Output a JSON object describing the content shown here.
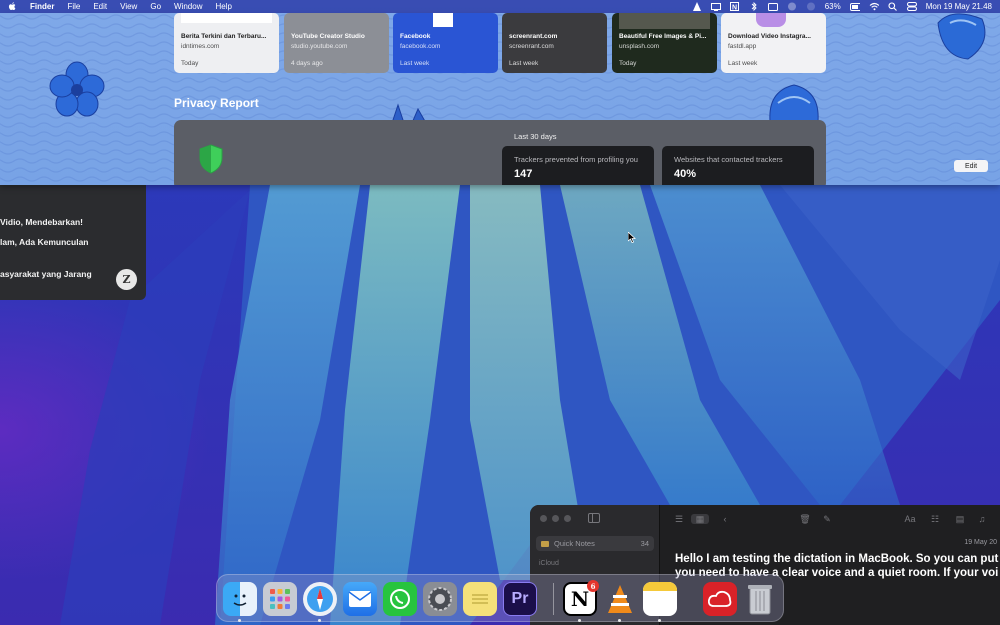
{
  "menubar": {
    "app_name": "Finder",
    "menus": [
      "File",
      "Edit",
      "View",
      "Go",
      "Window",
      "Help"
    ],
    "battery": "63%",
    "datetime": "Mon 19 May  21.48",
    "status_icons": [
      "vlc-icon",
      "display-icon",
      "notion-icon",
      "bluetooth-icon",
      "screen-icon",
      "dictation-icon",
      "shield-icon",
      "battery-icon",
      "wifi-icon",
      "search-icon",
      "control-center-icon"
    ]
  },
  "safari": {
    "cards": [
      {
        "title": "Berita Terkini dan Terbaru...",
        "domain": "idntimes.com",
        "time": "Today",
        "style": "light"
      },
      {
        "title": "YouTube Creator Studio",
        "domain": "studio.youtube.com",
        "time": "4 days ago",
        "style": "gray"
      },
      {
        "title": "Facebook",
        "domain": "facebook.com",
        "time": "Last week",
        "style": "blue"
      },
      {
        "title": "screenrant.com",
        "domain": "screenrant.com",
        "time": "Last week",
        "style": "dark"
      },
      {
        "title": "Beautiful Free Images & Pi...",
        "domain": "unsplash.com",
        "time": "Today",
        "style": "darkgreen"
      },
      {
        "title": "Download Video Instagra...",
        "domain": "fastdl.app",
        "time": "Last week",
        "style": "light"
      }
    ],
    "privacy_title": "Privacy Report",
    "privacy_period": "Last 30 days",
    "trackers_label": "Trackers prevented from profiling you",
    "trackers_value": "147",
    "websites_label": "Websites that contacted trackers",
    "websites_value": "40%",
    "edit_label": "Edit"
  },
  "news": {
    "headlines": [
      "Vidio, Mendebarkan!",
      "lam, Ada Kemunculan",
      "asyarakat yang Jarang"
    ]
  },
  "notes": {
    "folder_name": "Quick Notes",
    "folder_count": "34",
    "section_label": "iCloud",
    "date": "19 May 20",
    "body": "Hello I am testing the dictation in MacBook. So you can put you need to have a clear voice and a quiet room. If your voi"
  },
  "dock": {
    "apps": [
      {
        "name": "Finder",
        "icon": "finder-icon"
      },
      {
        "name": "Launchpad",
        "icon": "launchpad-icon"
      },
      {
        "name": "Safari",
        "icon": "safari-icon"
      },
      {
        "name": "Mail",
        "icon": "mail-icon"
      },
      {
        "name": "WhatsApp",
        "icon": "whatsapp-icon"
      },
      {
        "name": "System Settings",
        "icon": "settings-icon"
      },
      {
        "name": "Stickies",
        "icon": "stickies-icon"
      },
      {
        "name": "Premiere Pro",
        "icon": "premiere-icon",
        "label": "Pr"
      },
      {
        "name": "Notion",
        "icon": "notion-icon",
        "label": "N",
        "badge": "6"
      },
      {
        "name": "VLC",
        "icon": "vlc-icon"
      },
      {
        "name": "Notes",
        "icon": "notes-icon"
      },
      {
        "name": "Creative Cloud",
        "icon": "creative-cloud-icon"
      },
      {
        "name": "Trash",
        "icon": "trash-icon"
      }
    ]
  }
}
